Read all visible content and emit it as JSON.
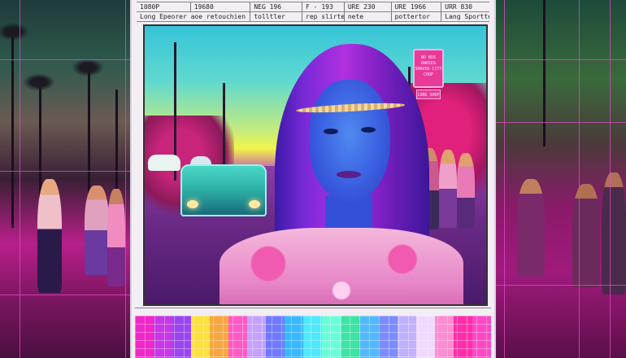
{
  "header": {
    "row1": [
      "1080P",
      "19680",
      "NEG 196",
      "F - 193",
      "URE 230",
      "URE 1966",
      "URR 830"
    ],
    "row2": [
      "Long Epeorer aoe retouchien",
      "tolltler",
      "rep slirte",
      "nete",
      "pottertor",
      "Lang Sportte"
    ]
  },
  "photo": {
    "sign_text": "NO BUS OWRIES SHAVED CITY CHOP",
    "sign2_text": "LONG SHOP"
  },
  "palette": [
    "#f027c8",
    "#c837e6",
    "#9a44f0",
    "#fde03e",
    "#f8a640",
    "#ff59c5",
    "#c4a2ff",
    "#6f79ff",
    "#3ab8ff",
    "#4ee8ff",
    "#68ffd8",
    "#3fe3a4",
    "#53b9ff",
    "#7c8cff",
    "#c2b0ff",
    "#f0d8ff",
    "#ff8bd0",
    "#ff2ea8",
    "#ff48c8"
  ]
}
